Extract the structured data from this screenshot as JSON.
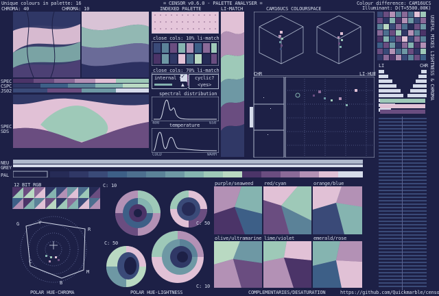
{
  "header": {
    "unique_colours": "Unique colours in palette: 16",
    "app_title": "= CENSOR v0.6.0 - PALETTE ANALYSER =",
    "colour_difference": "Colour difference: CAM16UCS",
    "illuminant": "Illuminant: D(T=5500.00K)"
  },
  "labels": {
    "chroma_40": "CHROMA: 40",
    "chroma_10": "CHROMA: 10",
    "indexed_palette": "INDEXED PALETTE",
    "li_match": "LI-MATCH",
    "cam16ucs": "CAM16UCS COLOURSPACE",
    "spec": "SPEC",
    "cspc": "CSPC",
    "js02": "JS02",
    "spec2": "SPEC",
    "sds": "SDS",
    "neu": "NEU",
    "grey": "GREY",
    "pal": "PAL",
    "close_cols_10": "close cols: 10% li-match",
    "close_cols_70": "close cols: 70% li-match",
    "internal_similarity": "internal similarity",
    "cyclic": "cyclic?",
    "yes": "<yes>",
    "spectral_distribution": "spectral distribution",
    "sd_min": "400",
    "sd_max": "650",
    "temperature": "temperature",
    "cold": "COLD",
    "warm": "WARM",
    "chr": "CHR",
    "li_hue": "LI-HUE",
    "li": "LI",
    "chr2": "CHR",
    "side_text": "USEFUL MIXES  LIGHTNESS  &  CHROMA",
    "bit_rgb": "12 BIT RGB",
    "c10_a": "C: 10",
    "c50_a": "C: 50",
    "c50_b": "C: 50",
    "c10_b": "C: 10",
    "purple_seaweed": "purple/seaweed",
    "red_cyan": "red/cyan",
    "orange_blue": "orange/blue",
    "olive_ultramarine": "olive/ultramarine",
    "lime_violet": "lime/violet",
    "emerald_rose": "emerald/rose",
    "footer_polar_hc": "POLAR HUE-CHROMA",
    "footer_polar_hl": "POLAR HUE-LIGHTNESS",
    "footer_comp": "COMPLEMENTARIES/DESATURATION",
    "footer_url": "https://github.com/Quickmarble/censor",
    "hue_g": "G",
    "hue_y": "Y",
    "hue_r": "R",
    "hue_c": "C",
    "hue_m": "M",
    "hue_b": "B"
  },
  "palette": [
    "#1d2046",
    "#262b56",
    "#303866",
    "#3a4a78",
    "#3d5f87",
    "#4d6f8f",
    "#5b8298",
    "#6e98a4",
    "#85b4b0",
    "#9ec9b8",
    "#b9d9c2",
    "#4b3468",
    "#6a4d80",
    "#8a6a98",
    "#b391b5",
    "#e1c1d6"
  ],
  "accent": "#1d2046"
}
